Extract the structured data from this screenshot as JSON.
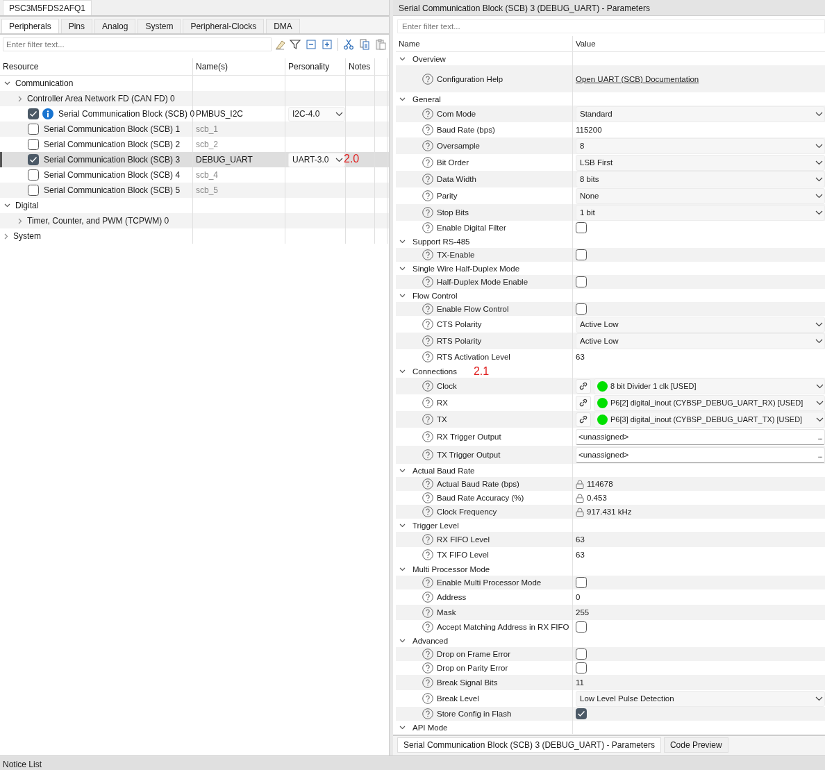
{
  "left_panel": {
    "document_tab": "PSC3M5FDS2AFQ1",
    "tabs": [
      {
        "label": "Peripherals",
        "selected": true
      },
      {
        "label": "Pins",
        "selected": false
      },
      {
        "label": "Analog",
        "selected": false
      },
      {
        "label": "System",
        "selected": false
      },
      {
        "label": "Peripheral-Clocks",
        "selected": false
      },
      {
        "label": "DMA",
        "selected": false
      }
    ],
    "filter": {
      "placeholder": "Enter filter text..."
    },
    "tree": {
      "columns": [
        "Resource",
        "Name(s)",
        "Personality",
        "Notes"
      ],
      "rows": [
        {
          "kind": "category",
          "label": "Communication",
          "expanded": true,
          "selected": false,
          "children": [
            {
              "kind": "category",
              "label": "Controller Area Network FD (CAN FD) 0",
              "expanded": false,
              "selected": false
            },
            {
              "kind": "block",
              "label": "Serial Communication Block (SCB) 0",
              "checked": true,
              "info": true,
              "name": "PMBUS_I2C",
              "personality": "I2C-4.0",
              "selected": false
            },
            {
              "kind": "block",
              "label": "Serial Communication Block (SCB) 1",
              "checked": false,
              "info": false,
              "name": "scb_1",
              "selected": false
            },
            {
              "kind": "block",
              "label": "Serial Communication Block (SCB) 2",
              "checked": false,
              "info": false,
              "name": "scb_2",
              "selected": false
            },
            {
              "kind": "block",
              "label": "Serial Communication Block (SCB) 3",
              "checked": true,
              "info": false,
              "name": "DEBUG_UART",
              "personality": "UART-3.0",
              "annotation": "2.0",
              "selected": true
            },
            {
              "kind": "block",
              "label": "Serial Communication Block (SCB) 4",
              "checked": false,
              "info": false,
              "name": "scb_4",
              "selected": false
            },
            {
              "kind": "block",
              "label": "Serial Communication Block (SCB) 5",
              "checked": false,
              "info": false,
              "name": "scb_5",
              "selected": false
            }
          ]
        },
        {
          "kind": "category",
          "label": "Digital",
          "expanded": true,
          "selected": false,
          "children": [
            {
              "kind": "category",
              "label": "Timer, Counter, and PWM (TCPWM) 0",
              "expanded": false,
              "selected": false
            }
          ]
        },
        {
          "kind": "category",
          "label": "System",
          "expanded": false,
          "selected": false
        }
      ]
    }
  },
  "parameters_panel": {
    "title": "Serial Communication Block (SCB) 3 (DEBUG_UART) - Parameters",
    "filter": {
      "placeholder": "Enter filter text..."
    },
    "columns": [
      "Name",
      "Value"
    ],
    "groups": [
      {
        "label": "Overview",
        "expanded": true,
        "params": [
          {
            "kind": "link",
            "label": "Configuration Help",
            "value": "Open UART (SCB) Documentation"
          }
        ]
      },
      {
        "label": "General",
        "expanded": true,
        "params": [
          {
            "kind": "dropdown",
            "label": "Com Mode",
            "value": "Standard"
          },
          {
            "kind": "text",
            "label": "Baud Rate (bps)",
            "value": "115200"
          },
          {
            "kind": "dropdown",
            "label": "Oversample",
            "value": "8"
          },
          {
            "kind": "dropdown",
            "label": "Bit Order",
            "value": "LSB First"
          },
          {
            "kind": "dropdown",
            "label": "Data Width",
            "value": "8 bits"
          },
          {
            "kind": "dropdown",
            "label": "Parity",
            "value": "None"
          },
          {
            "kind": "dropdown",
            "label": "Stop Bits",
            "value": "1 bit"
          },
          {
            "kind": "checkbox",
            "label": "Enable Digital Filter",
            "checked": false
          }
        ]
      },
      {
        "label": "Support RS-485",
        "expanded": true,
        "params": [
          {
            "kind": "checkbox",
            "label": "TX-Enable",
            "checked": false
          }
        ]
      },
      {
        "label": "Single Wire Half-Duplex Mode",
        "expanded": true,
        "params": [
          {
            "kind": "checkbox",
            "label": "Half-Duplex Mode Enable",
            "checked": false
          }
        ]
      },
      {
        "label": "Flow Control",
        "expanded": true,
        "params": [
          {
            "kind": "checkbox",
            "label": "Enable Flow Control",
            "checked": false
          },
          {
            "kind": "dropdown",
            "label": "CTS Polarity",
            "value": "Active Low"
          },
          {
            "kind": "dropdown",
            "label": "RTS Polarity",
            "value": "Active Low"
          },
          {
            "kind": "text",
            "label": "RTS Activation Level",
            "value": "63"
          }
        ]
      },
      {
        "label": "Connections",
        "expanded": true,
        "annotation": "2.1",
        "params": [
          {
            "kind": "connection",
            "label": "Clock",
            "value": "8 bit Divider 1 clk [USED]",
            "color": "#00e000"
          },
          {
            "kind": "connection",
            "label": "RX",
            "value": "P6[2] digital_inout (CYBSP_DEBUG_UART_RX) [USED]",
            "color": "#00e000"
          },
          {
            "kind": "connection",
            "label": "TX",
            "value": "P6[3] digital_inout (CYBSP_DEBUG_UART_TX) [USED]",
            "color": "#00e000"
          },
          {
            "kind": "field",
            "label": "RX Trigger Output",
            "value": "<unassigned>",
            "button": "..."
          },
          {
            "kind": "field",
            "label": "TX Trigger Output",
            "value": "<unassigned>",
            "button": "..."
          }
        ]
      },
      {
        "label": "Actual Baud Rate",
        "expanded": true,
        "params": [
          {
            "kind": "locked",
            "label": "Actual Baud Rate (bps)",
            "value": "114678"
          },
          {
            "kind": "locked",
            "label": "Baud Rate Accuracy (%)",
            "value": "0.453"
          },
          {
            "kind": "locked",
            "label": "Clock Frequency",
            "value": "917.431 kHz"
          }
        ]
      },
      {
        "label": "Trigger Level",
        "expanded": true,
        "params": [
          {
            "kind": "text",
            "label": "RX FIFO Level",
            "value": "63"
          },
          {
            "kind": "text",
            "label": "TX FIFO Level",
            "value": "63"
          }
        ]
      },
      {
        "label": "Multi Processor Mode",
        "expanded": true,
        "params": [
          {
            "kind": "checkbox",
            "label": "Enable Multi Processor Mode",
            "checked": false
          },
          {
            "kind": "text",
            "label": "Address",
            "value": "0"
          },
          {
            "kind": "text",
            "label": "Mask",
            "value": "255"
          },
          {
            "kind": "checkbox",
            "label": "Accept Matching Address in RX FIFO",
            "checked": false
          }
        ]
      },
      {
        "label": "Advanced",
        "expanded": true,
        "params": [
          {
            "kind": "checkbox",
            "label": "Drop on Frame Error",
            "checked": false
          },
          {
            "kind": "checkbox",
            "label": "Drop on Parity Error",
            "checked": false
          },
          {
            "kind": "text",
            "label": "Break Signal Bits",
            "value": "11"
          },
          {
            "kind": "dropdown",
            "label": "Break Level",
            "value": "Low Level Pulse Detection"
          },
          {
            "kind": "checkbox",
            "label": "Store Config in Flash",
            "checked": true
          }
        ]
      },
      {
        "label": "API Mode",
        "expanded": true
      }
    ],
    "bottom_tabs": [
      {
        "label": "Serial Communication Block (SCB) 3 (DEBUG_UART) - Parameters",
        "selected": true
      },
      {
        "label": "Code Preview",
        "selected": false
      }
    ]
  },
  "notice_list": "Notice List"
}
